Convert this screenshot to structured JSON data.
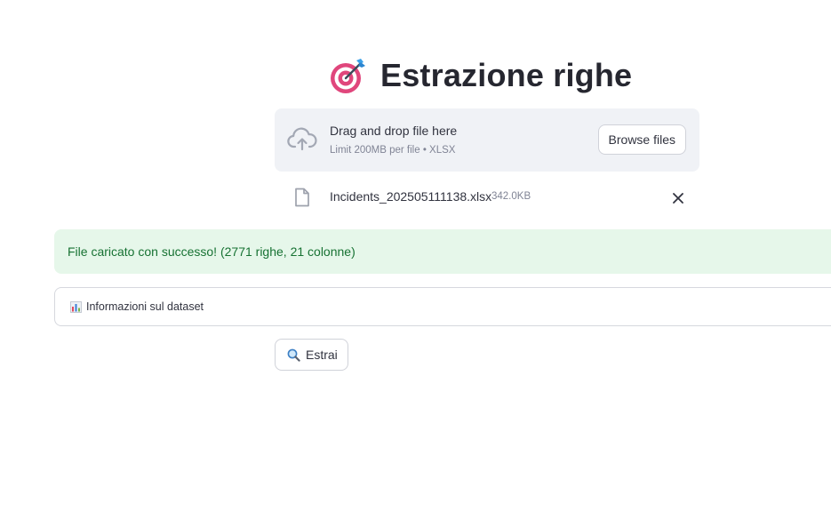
{
  "header": {
    "title": "Estrazione righe",
    "title_icon": "target-icon"
  },
  "uploader": {
    "drop_label": "Drag and drop file here",
    "limit_text": "Limit 200MB per file • XLSX",
    "browse_label": "Browse files",
    "upload_icon": "cloud-upload-icon"
  },
  "uploaded_file": {
    "name": "Incidents_202505111138.xlsx",
    "size": "342.0KB",
    "file_icon": "file-icon",
    "remove_icon": "close-icon"
  },
  "alert": {
    "message": "File caricato con successo! (2771 righe, 21 colonne)",
    "type": "success",
    "bg_color": "#e6f7ea",
    "text_color": "#177233"
  },
  "expander": {
    "label": "Informazioni sul dataset",
    "icon": "bar-chart-icon"
  },
  "actions": {
    "extract_label": "Estrai",
    "extract_icon": "magnifier-icon"
  }
}
